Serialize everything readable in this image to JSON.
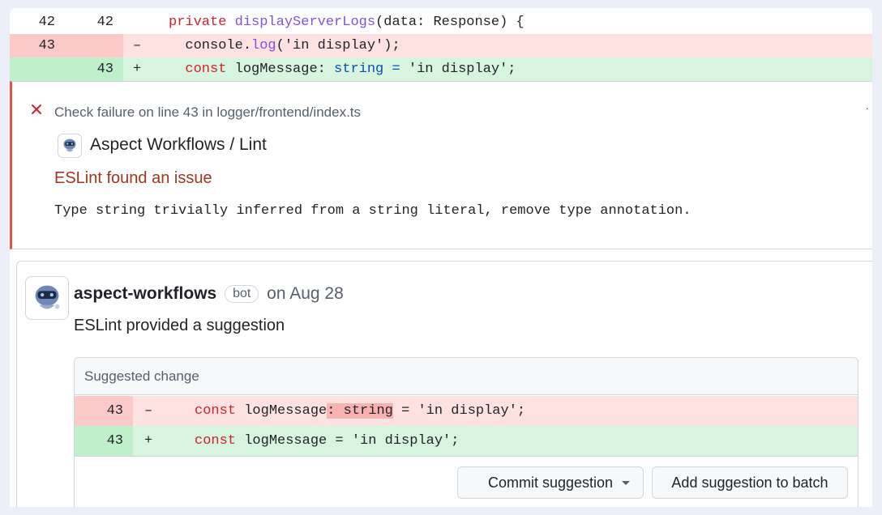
{
  "diff": {
    "context": {
      "old_ln": "42",
      "new_ln": "42",
      "sign": "",
      "code_kw": "private ",
      "code_fn": "displayServerLogs",
      "code_rest": "(data: Response) {"
    },
    "deleted": {
      "old_ln": "43",
      "sign": "–",
      "code_pre": "  console.",
      "code_fn": "log",
      "code_rest": "('in display');"
    },
    "added": {
      "new_ln": "43",
      "sign": "+",
      "code_kw": "  const ",
      "code_mid": "logMessage: ",
      "code_type": "string",
      "code_eq": " = ",
      "code_str": "'in display';"
    }
  },
  "annotation": {
    "failure_text": "Check failure on line 43 in logger/frontend/index.ts",
    "app_name": "Aspect Workflows",
    "app_sub": " / Lint",
    "issue_title": "ESLint found an issue",
    "issue_message": "Type string trivially inferred from a string literal, remove type annotation.",
    "more_marker": "·"
  },
  "comment": {
    "author": "aspect-workflows",
    "badge": "bot",
    "date": "on Aug 28",
    "body": "ESLint provided a suggestion",
    "suggestion": {
      "header": "Suggested change",
      "deleted": {
        "ln": "43",
        "sign": "–",
        "kw": "const ",
        "name": "logMessage",
        "hl": ": string",
        "rest": " = 'in display';"
      },
      "added": {
        "ln": "43",
        "sign": "+",
        "kw": "const ",
        "rest": "logMessage = 'in display';"
      },
      "commit_label": "Commit suggestion",
      "batch_label": "Add suggestion to batch"
    }
  },
  "colors": {
    "deleted_bg": "#fde2e1",
    "added_bg": "#d7f5de",
    "failure_accent": "#e5534b",
    "issue_title": "#a0361d"
  }
}
